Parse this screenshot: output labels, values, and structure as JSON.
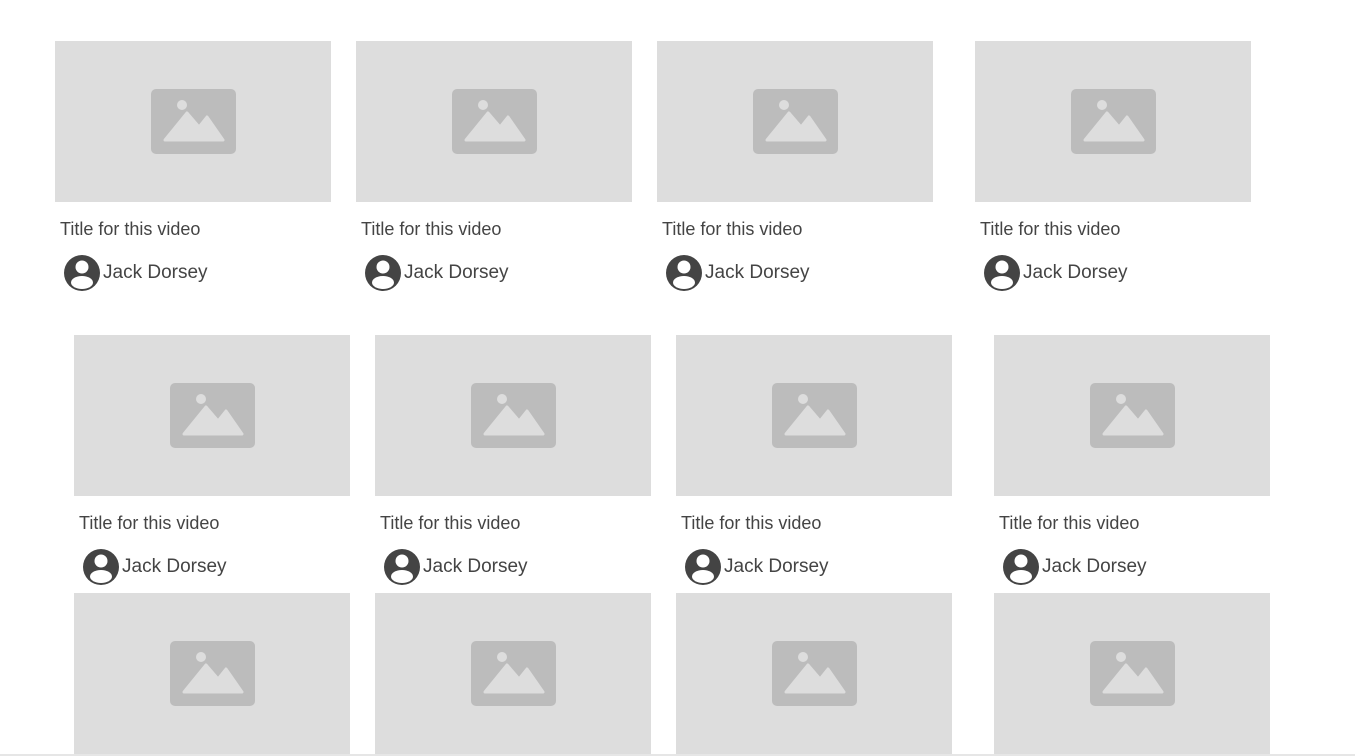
{
  "icons": {
    "thumbnail": "image-placeholder-icon",
    "avatar": "account-circle-icon"
  },
  "colors": {
    "thumbnail_bg": "#dddddd",
    "placeholder": "#bcbcbc",
    "text": "#444444"
  },
  "videos": [
    {
      "title": "Title for this video",
      "channel": "Jack Dorsey"
    },
    {
      "title": "Title for this video",
      "channel": "Jack Dorsey"
    },
    {
      "title": "Title for this video",
      "channel": "Jack Dorsey"
    },
    {
      "title": "Title for this video",
      "channel": "Jack Dorsey"
    },
    {
      "title": "Title for this video",
      "channel": "Jack Dorsey"
    },
    {
      "title": "Title for this video",
      "channel": "Jack Dorsey"
    },
    {
      "title": "Title for this video",
      "channel": "Jack Dorsey"
    },
    {
      "title": "Title for this video",
      "channel": "Jack Dorsey"
    }
  ],
  "partial_videos_visible": 4
}
